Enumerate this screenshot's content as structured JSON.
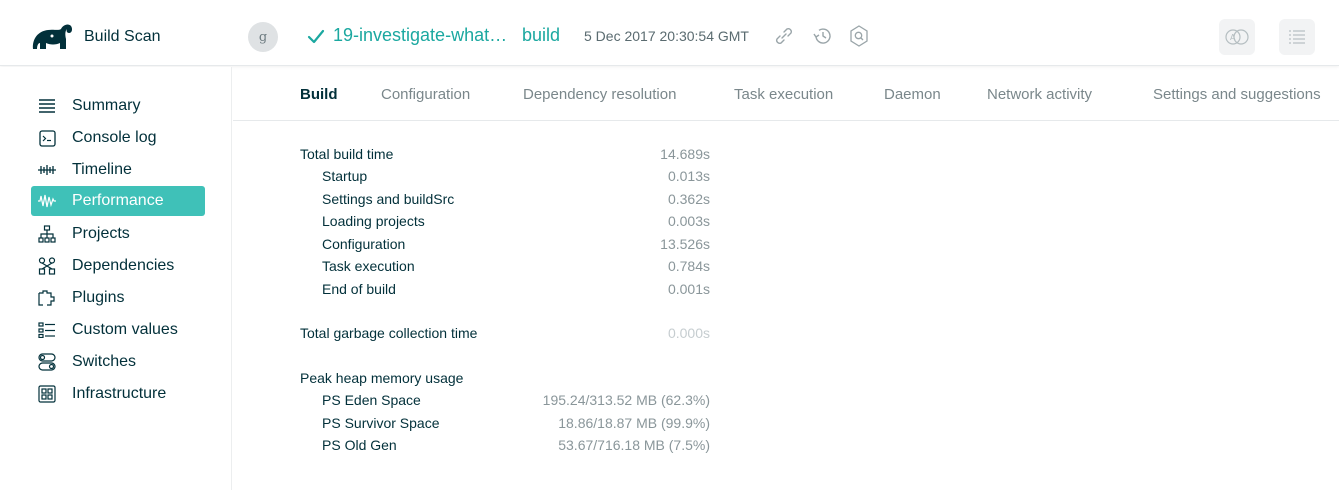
{
  "header": {
    "brand": "Build Scan",
    "avatar_letter": "g",
    "build_name": "19-investigate-what…",
    "build_task": "build",
    "timestamp": "5 Dec 2017 20:30:54 GMT",
    "icons": [
      "link-icon",
      "history-icon",
      "search-scan-icon",
      "compare-icon",
      "list-icon"
    ],
    "accent_color": "#1ba8a0"
  },
  "sidebar": {
    "items": [
      {
        "label": "Summary",
        "icon": "summary-icon"
      },
      {
        "label": "Console log",
        "icon": "console-icon"
      },
      {
        "label": "Timeline",
        "icon": "timeline-icon"
      },
      {
        "label": "Performance",
        "icon": "performance-icon",
        "active": true
      },
      {
        "label": "Projects",
        "icon": "projects-icon"
      },
      {
        "label": "Dependencies",
        "icon": "dependencies-icon"
      },
      {
        "label": "Plugins",
        "icon": "plugins-icon"
      },
      {
        "label": "Custom values",
        "icon": "custom-values-icon"
      },
      {
        "label": "Switches",
        "icon": "switches-icon"
      },
      {
        "label": "Infrastructure",
        "icon": "infrastructure-icon"
      }
    ],
    "active_color": "#3fc1b8"
  },
  "tabs": [
    {
      "label": "Build",
      "active": true
    },
    {
      "label": "Configuration"
    },
    {
      "label": "Dependency resolution"
    },
    {
      "label": "Task execution"
    },
    {
      "label": "Daemon"
    },
    {
      "label": "Network activity"
    },
    {
      "label": "Settings and suggestions"
    }
  ],
  "build": {
    "total_build_time": {
      "label": "Total build time",
      "value": "14.689s"
    },
    "phases": [
      {
        "label": "Startup",
        "value": "0.013s"
      },
      {
        "label": "Settings and buildSrc",
        "value": "0.362s"
      },
      {
        "label": "Loading projects",
        "value": "0.003s"
      },
      {
        "label": "Configuration",
        "value": "13.526s"
      },
      {
        "label": "Task execution",
        "value": "0.784s"
      },
      {
        "label": "End of build",
        "value": "0.001s"
      }
    ],
    "gc_time": {
      "label": "Total garbage collection time",
      "value": "0.000s"
    },
    "heap": {
      "label": "Peak heap memory usage",
      "spaces": [
        {
          "label": "PS Eden Space",
          "value": "195.24/313.52 MB (62.3%)"
        },
        {
          "label": "PS Survivor Space",
          "value": "18.86/18.87 MB (99.9%)"
        },
        {
          "label": "PS Old Gen",
          "value": "53.67/716.18 MB (7.5%)"
        }
      ]
    }
  }
}
